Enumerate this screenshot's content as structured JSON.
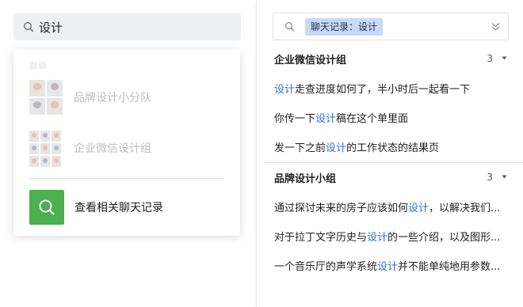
{
  "left": {
    "search": {
      "value": "设计"
    },
    "dropdown": {
      "section_label": "群聊",
      "groups": [
        {
          "name": "品牌设计小分队"
        },
        {
          "name": "企业微信设计组"
        }
      ],
      "action_label": "查看相关聊天记录",
      "action_color": "#4caf50"
    }
  },
  "right": {
    "search_tag": "聊天记录：设计",
    "results": [
      {
        "group": "企业微信设计组",
        "count": "3",
        "messages": [
          {
            "pre": "",
            "hl": "设计",
            "post": "走查进度如何了，半小时后一起看一下"
          },
          {
            "pre": "你传一下",
            "hl": "设计",
            "post": "稿在这个单里面"
          },
          {
            "pre": "发一下之前",
            "hl": "设计",
            "post": "的工作状态的结果页"
          }
        ]
      },
      {
        "group": "品牌设计小组",
        "count": "3",
        "messages": [
          {
            "pre": "通过探讨未来的房子应该如何",
            "hl": "设计",
            "post": "，以解决我们..."
          },
          {
            "pre": "对于拉丁文字历史与",
            "hl": "设计",
            "post": "的一些介绍，以及图形..."
          },
          {
            "pre": "一个音乐厅的声学系统",
            "hl": "设计",
            "post": "并不能单纯地用参数..."
          }
        ]
      }
    ],
    "highlight_color": "#2f6fd1"
  }
}
